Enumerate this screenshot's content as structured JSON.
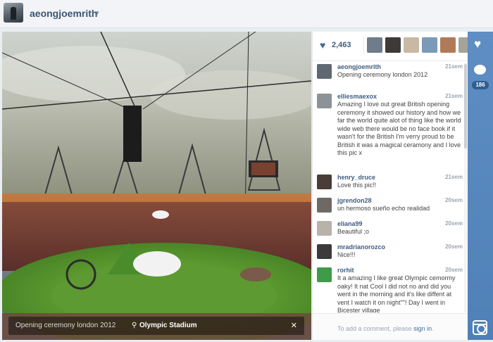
{
  "header": {
    "username": "aeongjoemrith",
    "caret": "▾"
  },
  "photo": {
    "caption": "Opening ceremony london 2012",
    "location": "Olympic Stadium",
    "pin_icon": "map-pin-icon",
    "close": "✕"
  },
  "likes": {
    "heart_icon": "heart-icon",
    "count": "2,463"
  },
  "comments": [
    {
      "user": "aeongjoemrith",
      "time": "21sem",
      "text": "Opening ceremony london 2012",
      "avatar_color": "#5f6870"
    },
    {
      "user": "elliesmaexox",
      "time": "21sem",
      "text": "Amazing I love out great British opening ceremony it showed our history and how we far the world quite alot of thing like the world wide web there would be no face book if it wasn't for the British I'm verry proud to be British it was a magical ceramony and I love this pic x",
      "avatar_color": "#8c9298"
    },
    {
      "user": "henry_druce",
      "time": "21sem",
      "text": "Love this pic!!",
      "avatar_color": "#4a3c36"
    },
    {
      "user": "jgrendon28",
      "time": "20sem",
      "text": "un hermoso sueño echo realidad",
      "avatar_color": "#6e6a63"
    },
    {
      "user": "eliana99",
      "time": "20sem",
      "text": "Beautiful ;o",
      "avatar_color": "#b8b2aa"
    },
    {
      "user": "mradrianorozco",
      "time": "20sem",
      "text": "Nice!!!",
      "avatar_color": "#3c3a3a"
    },
    {
      "user": "rorhit",
      "time": "20sem",
      "text": "It a amazing I like great Olympic cemormy oaky! It nat Cool I did not no and did you went in the morning and it's like diffent at vent I watch it on night\"\"! Day I went in Bicester village",
      "avatar_color": "#3f9a4a"
    }
  ],
  "add_comment": {
    "prefix": "To add a comment, please ",
    "link": "sign in",
    "suffix": "."
  },
  "rail": {
    "like_icon": "heart-icon",
    "comment_icon": "comment-bubble-icon",
    "comment_count": "186",
    "app_icon": "instagram-camera-icon"
  },
  "colors": {
    "accent": "#3f6b9a",
    "rail": "#5e8ec3"
  }
}
